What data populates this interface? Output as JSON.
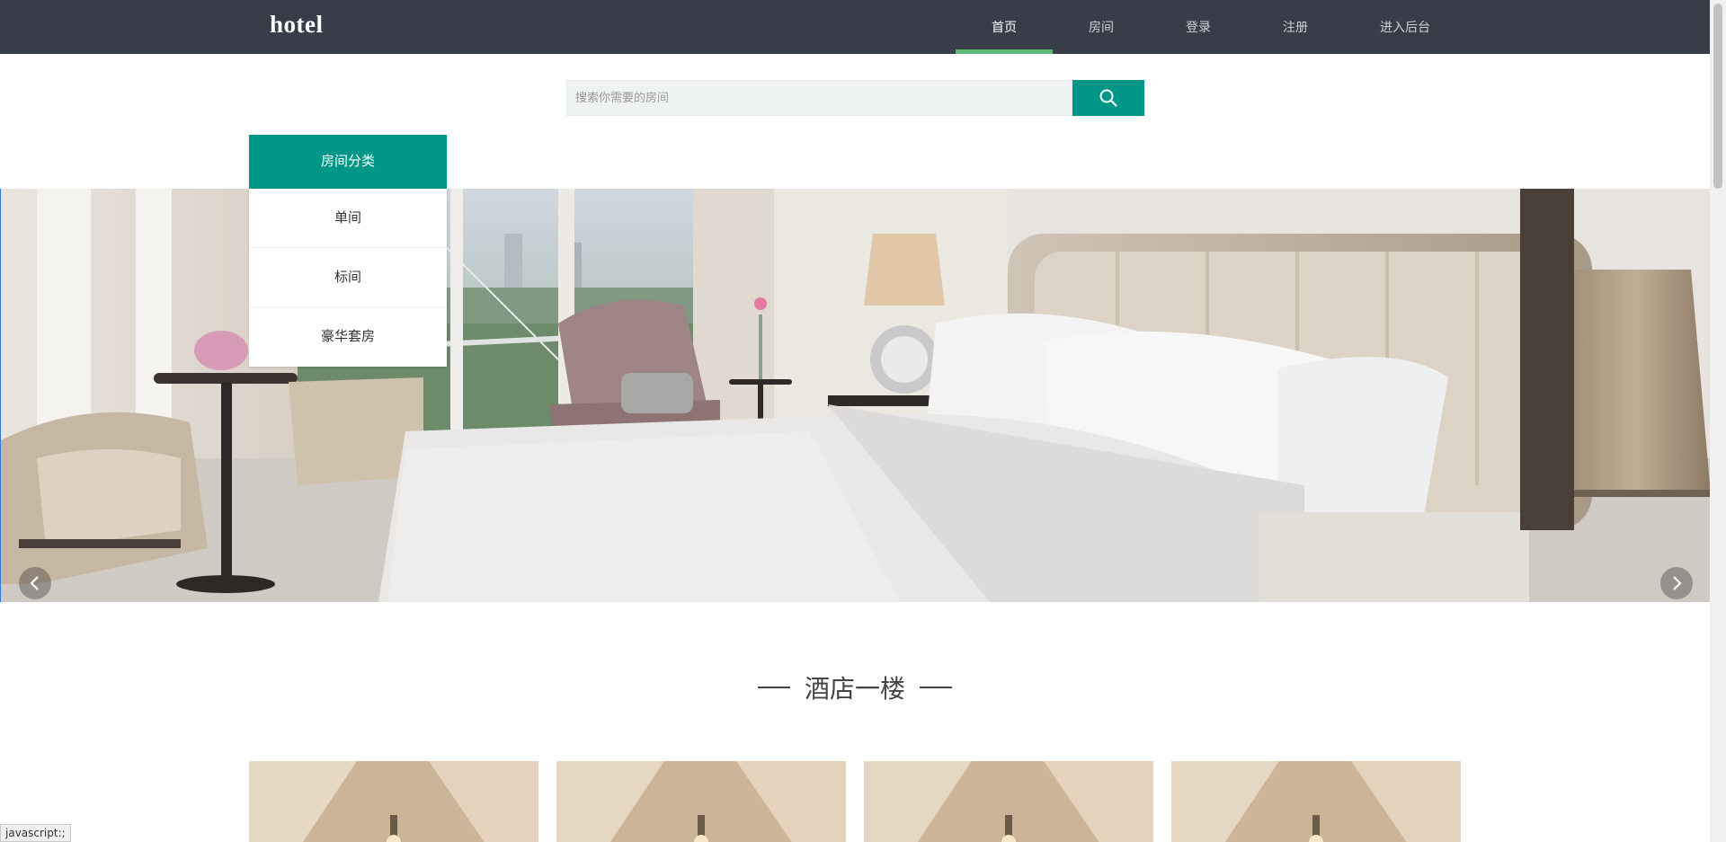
{
  "header": {
    "logo": "hotel",
    "nav": [
      {
        "label": "首页",
        "active": true
      },
      {
        "label": "房间",
        "active": false
      },
      {
        "label": "登录",
        "active": false
      },
      {
        "label": "注册",
        "active": false
      },
      {
        "label": "进入后台",
        "active": false
      }
    ]
  },
  "search": {
    "placeholder": "搜索你需要的房间",
    "button_icon": "search-icon"
  },
  "category": {
    "title": "房间分类",
    "items": [
      "单间",
      "标间",
      "豪华套房"
    ]
  },
  "carousel": {
    "slide_count": 6,
    "active_index": 0,
    "prev_icon": "chevron-left-icon",
    "next_icon": "chevron-right-icon"
  },
  "section": {
    "title": "酒店一楼"
  },
  "status_bar": {
    "text": "javascript:;"
  },
  "colors": {
    "topbar": "#393d49",
    "accent": "#009688",
    "nav_active_underline": "#5fb878"
  }
}
